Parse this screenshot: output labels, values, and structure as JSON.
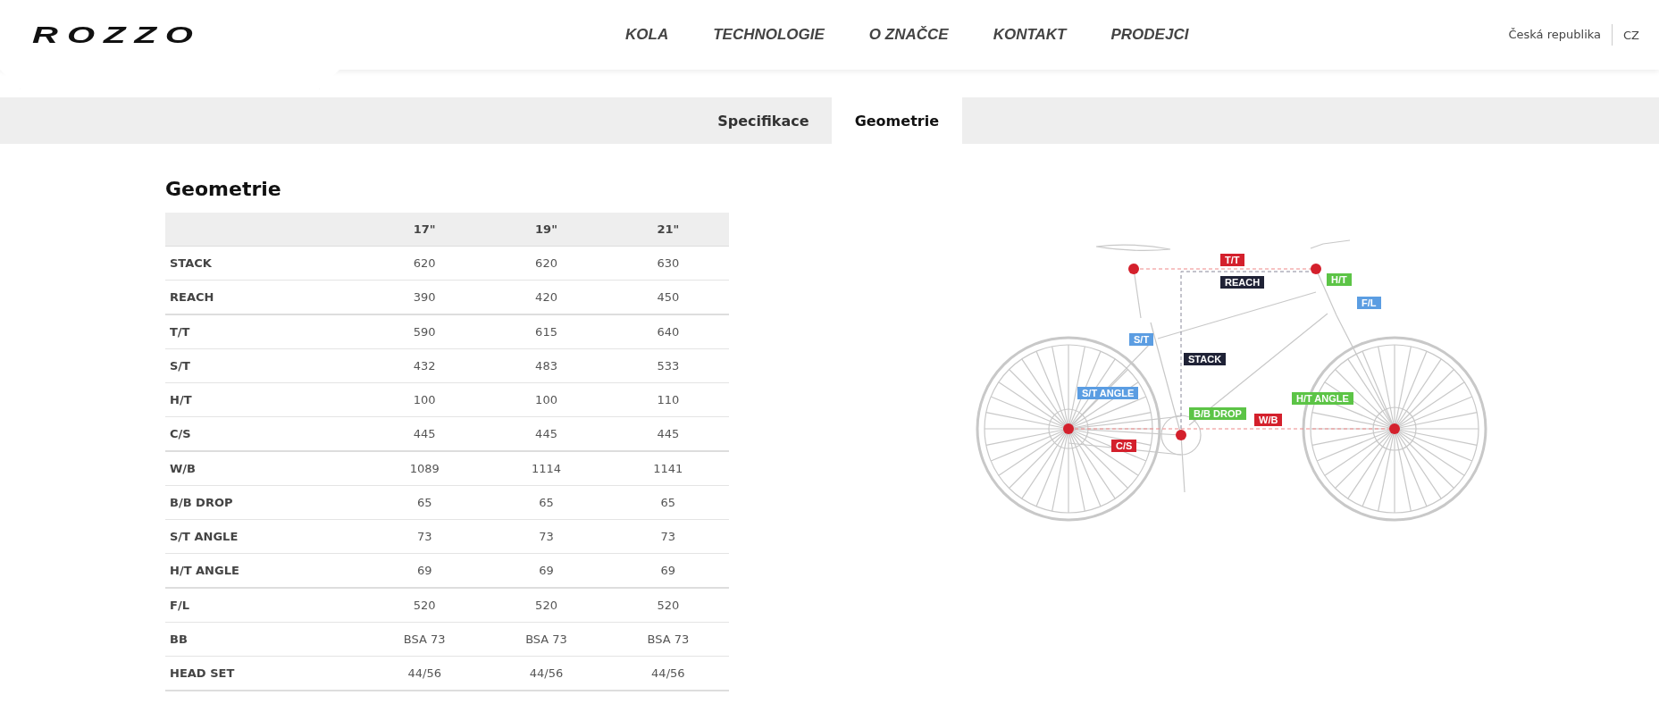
{
  "header": {
    "logo": "ROZZO",
    "nav": [
      "KOLA",
      "TECHNOLOGIE",
      "O ZNAČCE",
      "KONTAKT",
      "PRODEJCI"
    ],
    "country": "Česká republika",
    "language": "CZ"
  },
  "tabs": [
    {
      "label": "Specifikace",
      "selected": false
    },
    {
      "label": "Geometrie",
      "selected": true
    }
  ],
  "heading": "Geometrie",
  "table": {
    "columns": [
      "17\"",
      "19\"",
      "21\""
    ],
    "row_groups": [
      [
        {
          "label": "STACK",
          "values": [
            "620",
            "620",
            "630"
          ]
        },
        {
          "label": "REACH",
          "values": [
            "390",
            "420",
            "450"
          ]
        }
      ],
      [
        {
          "label": "T/T",
          "values": [
            "590",
            "615",
            "640"
          ]
        },
        {
          "label": "S/T",
          "values": [
            "432",
            "483",
            "533"
          ]
        },
        {
          "label": "H/T",
          "values": [
            "100",
            "100",
            "110"
          ]
        },
        {
          "label": "C/S",
          "values": [
            "445",
            "445",
            "445"
          ]
        }
      ],
      [
        {
          "label": "W/B",
          "values": [
            "1089",
            "1114",
            "1141"
          ]
        },
        {
          "label": "B/B DROP",
          "values": [
            "65",
            "65",
            "65"
          ]
        },
        {
          "label": "S/T ANGLE",
          "values": [
            "73",
            "73",
            "73"
          ]
        },
        {
          "label": "H/T ANGLE",
          "values": [
            "69",
            "69",
            "69"
          ]
        }
      ],
      [
        {
          "label": "F/L",
          "values": [
            "520",
            "520",
            "520"
          ]
        },
        {
          "label": "BB",
          "values": [
            "BSA 73",
            "BSA 73",
            "BSA 73"
          ]
        },
        {
          "label": "HEAD SET",
          "values": [
            "44/56",
            "44/56",
            "44/56"
          ]
        }
      ]
    ]
  },
  "diagram": {
    "labels": [
      {
        "text": "T/T",
        "color": "#d4202c"
      },
      {
        "text": "REACH",
        "color": "#1f2236"
      },
      {
        "text": "H/T",
        "color": "#5cc446"
      },
      {
        "text": "F/L",
        "color": "#5b9de2"
      },
      {
        "text": "S/T",
        "color": "#5b9de2"
      },
      {
        "text": "STACK",
        "color": "#1f2236"
      },
      {
        "text": "S/T ANGLE",
        "color": "#5b9de2"
      },
      {
        "text": "B/B DROP",
        "color": "#5cc446"
      },
      {
        "text": "W/B",
        "color": "#d4202c"
      },
      {
        "text": "H/T ANGLE",
        "color": "#5cc446"
      },
      {
        "text": "C/S",
        "color": "#d4202c"
      }
    ]
  }
}
